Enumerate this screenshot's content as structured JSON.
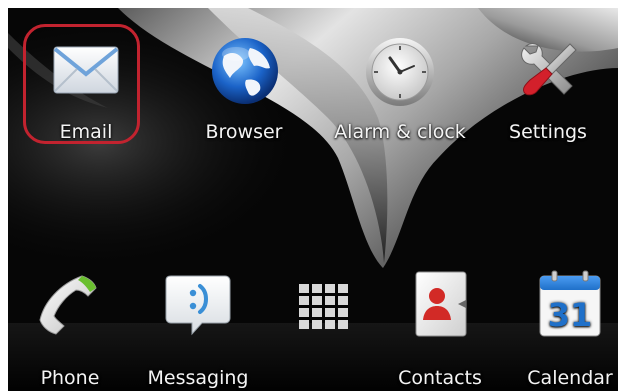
{
  "home_apps": [
    {
      "id": "email",
      "label": "Email",
      "icon": "envelope-icon",
      "highlighted": true
    },
    {
      "id": "browser",
      "label": "Browser",
      "icon": "globe-icon"
    },
    {
      "id": "alarm",
      "label": "Alarm & clock",
      "icon": "clock-icon"
    },
    {
      "id": "settings",
      "label": "Settings",
      "icon": "wrench-screwdriver-icon"
    }
  ],
  "dock_apps": [
    {
      "id": "phone",
      "label": "Phone",
      "icon": "phone-handset-icon"
    },
    {
      "id": "messaging",
      "label": "Messaging",
      "icon": "speech-bubble-icon"
    },
    {
      "id": "app_drawer",
      "label": "",
      "icon": "app-grid-icon"
    },
    {
      "id": "contacts",
      "label": "Contacts",
      "icon": "contact-card-icon"
    },
    {
      "id": "calendar",
      "label": "Calendar",
      "icon": "calendar-icon",
      "date": "31"
    }
  ],
  "colors": {
    "highlight": "#c2232f",
    "background": "#050505",
    "calendar_blue": "#1f70c9",
    "contact_red": "#d22a26"
  }
}
